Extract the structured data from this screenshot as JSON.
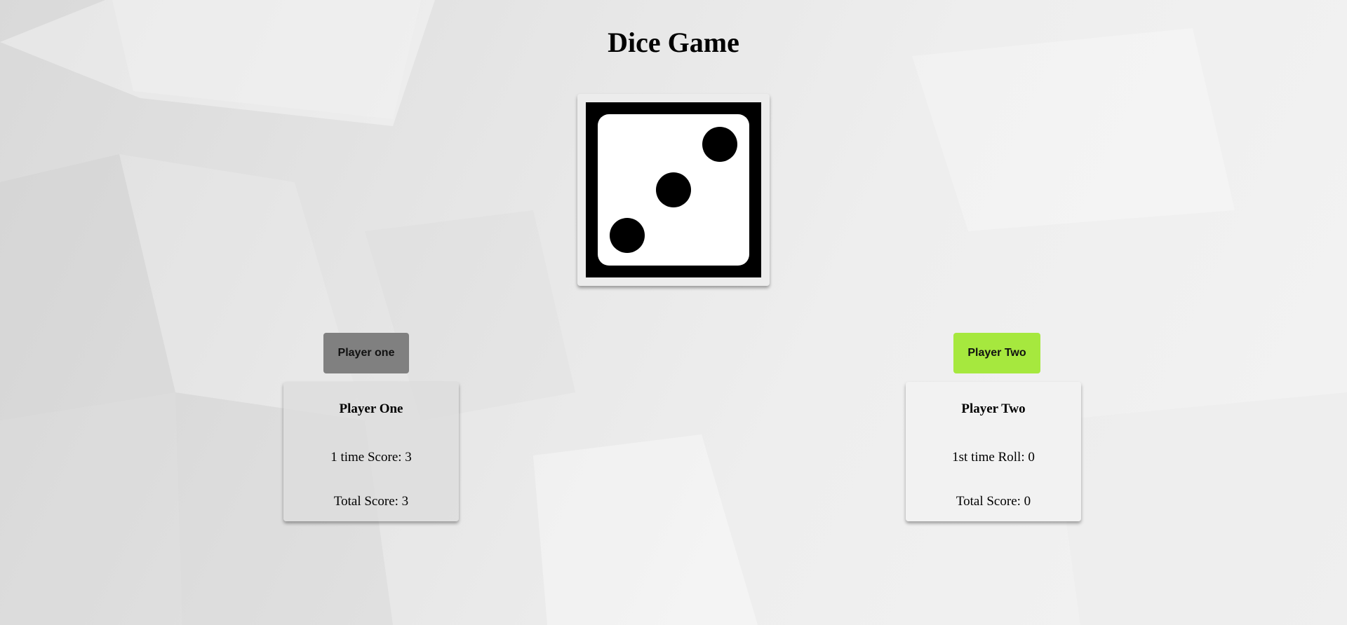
{
  "page": {
    "title": "Dice Game"
  },
  "dice": {
    "face_value": 3,
    "icon": "die-face-three-icon"
  },
  "buttons": {
    "player_one_label": "Player one",
    "player_two_label": "Player Two"
  },
  "players": [
    {
      "name": "Player One",
      "roll_text": "1 time Score: 3",
      "total_text": "Total Score: 3"
    },
    {
      "name": "Player Two",
      "roll_text": "1st time Roll: 0",
      "total_text": "Total Score: 0"
    }
  ],
  "colors": {
    "player_one_button": "#808080",
    "player_two_button": "#a6e83e"
  }
}
